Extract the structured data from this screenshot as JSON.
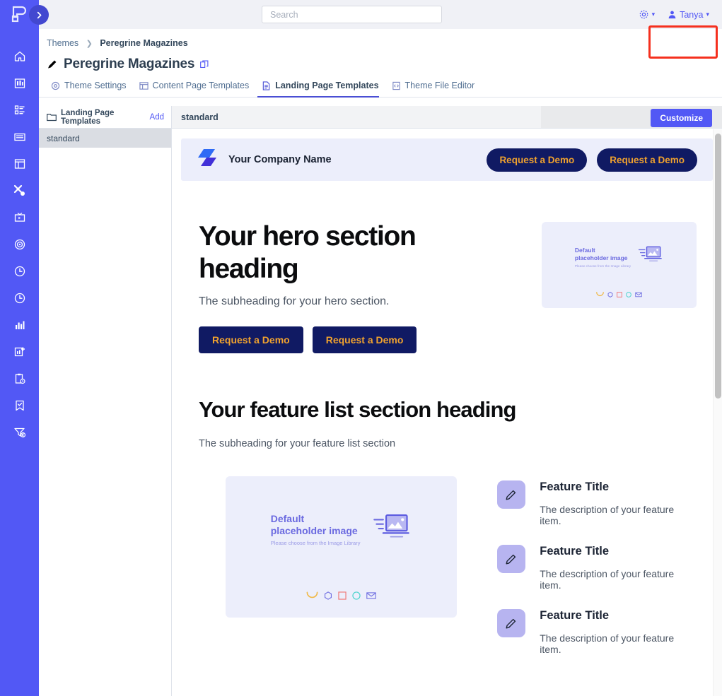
{
  "rail": {
    "logo_icon": "peregrine-logo-icon",
    "expand_icon": "chevron-right-icon",
    "items": [
      {
        "name": "home-icon"
      },
      {
        "name": "library-icon"
      },
      {
        "name": "dashboard-icon"
      },
      {
        "name": "keyboard-icon"
      },
      {
        "name": "layout-icon"
      },
      {
        "name": "tools-icon"
      },
      {
        "name": "media-icon"
      },
      {
        "name": "target-icon"
      },
      {
        "name": "clock-icon"
      },
      {
        "name": "clock-alt-icon"
      },
      {
        "name": "bar-chart-icon"
      },
      {
        "name": "add-report-icon"
      },
      {
        "name": "clipboard-clock-icon"
      },
      {
        "name": "bookmark-check-icon"
      },
      {
        "name": "funnel-euro-icon"
      }
    ]
  },
  "topbar": {
    "search": {
      "placeholder": "Search",
      "value": "",
      "icon": "search-icon"
    },
    "settings": {
      "label": "",
      "icon": "gear-icon",
      "caret": "chevron-down-icon"
    },
    "user": {
      "label": "Tanya",
      "icon": "user-icon",
      "caret": "chevron-down-icon"
    }
  },
  "breadcrumb": {
    "parent": "Themes",
    "separator": "›",
    "current": "Peregrine Magazines"
  },
  "page_title": {
    "text": "Peregrine Magazines",
    "edit_icon": "pencil-icon",
    "copy_icon": "copy-icon"
  },
  "tabs": [
    {
      "label": "Theme Settings",
      "icon": "settings-gear-icon",
      "active": false
    },
    {
      "label": "Content Page Templates",
      "icon": "layout-template-icon",
      "active": false
    },
    {
      "label": "Landing Page Templates",
      "icon": "document-icon",
      "active": true
    },
    {
      "label": "Theme File Editor",
      "icon": "file-code-icon",
      "active": false
    }
  ],
  "template_sidebar": {
    "folder_icon": "folder-icon",
    "heading": "Landing Page Templates",
    "add_label": "Add",
    "items": [
      {
        "label": "standard",
        "selected": true
      }
    ]
  },
  "preview_toolbar": {
    "template_name": "standard",
    "customize_label": "Customize",
    "highlight_color": "#f5301e",
    "accent_color": "#5258f5"
  },
  "landing_page": {
    "header": {
      "logo_icon": "company-logo-icon",
      "company_name": "Your Company Name",
      "buttons": [
        "Request a Demo",
        "Request a Demo"
      ]
    },
    "hero": {
      "heading": "Your hero section heading",
      "subheading": "The subheading for your hero section.",
      "buttons": [
        "Request a Demo",
        "Request a Demo"
      ],
      "image": {
        "title_line1": "Default",
        "title_line2": "placeholder image",
        "caption": "Please choose from the Image Library",
        "icon": "laptop-image-icon"
      }
    },
    "feature_section": {
      "heading": "Your feature list section heading",
      "subheading": "The subheading for your feature list section",
      "image": {
        "title_line1": "Default",
        "title_line2": "placeholder image",
        "caption": "Please choose from the Image Library",
        "icon": "laptop-image-icon"
      },
      "items": [
        {
          "icon": "pencil-icon",
          "title": "Feature Title",
          "description": "The description of your feature item."
        },
        {
          "icon": "pencil-icon",
          "title": "Feature Title",
          "description": "The description of your feature item."
        },
        {
          "icon": "pencil-icon",
          "title": "Feature Title",
          "description": "The description of your feature item."
        }
      ]
    },
    "button_colors": {
      "background": "#101a63",
      "text": "#f0a22e"
    }
  },
  "scrollbar": {
    "position_percent": 2
  }
}
